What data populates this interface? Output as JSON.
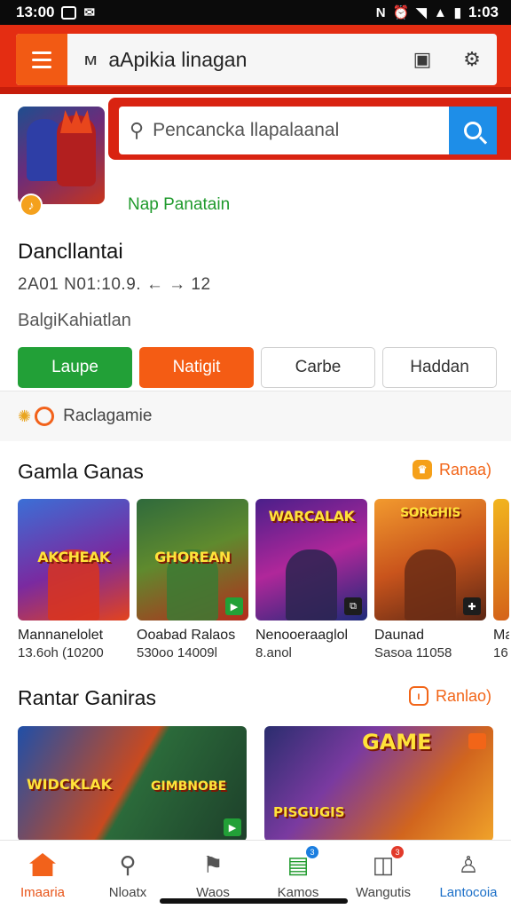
{
  "status_bar": {
    "time": "13:00",
    "right_time": "1:03"
  },
  "header": {
    "app_title": "aApikia linagan"
  },
  "search": {
    "placeholder": "Pencancka llapalaanal"
  },
  "hero": {
    "map_link": "Nap Panatain"
  },
  "info": {
    "headline": "Dancllantai",
    "meta": "2A01 N01:10.9. ← → 12",
    "subhead": "BalgiKahiatlan"
  },
  "action_buttons": [
    "Laupe",
    "Natigit",
    "Carbe",
    "Haddan"
  ],
  "ranking": {
    "label": "Raclagamie"
  },
  "section1": {
    "title": "Gamla Ganas",
    "link": "Ranaa)",
    "cards": [
      {
        "art_title": "AKCHEAK",
        "name": "Mannanelolet",
        "stat": "13.6oh (10200"
      },
      {
        "art_title": "GHOREAN",
        "name": "Ooabad Ralaos",
        "stat": "530oo 14009l"
      },
      {
        "art_title": "WARCALAK",
        "name": "Nenooeraaglol",
        "stat": "8.anol"
      },
      {
        "art_title": "SORGHIS",
        "name": "Daunad",
        "stat": "Sasoa 11058"
      },
      {
        "art_title": "",
        "name": "Ma",
        "stat": "16"
      }
    ]
  },
  "section2": {
    "title": "Rantar Ganiras",
    "link": "Ranlao)",
    "cards": [
      {
        "art_title": "WIDCKLAK"
      },
      {
        "art_title": "GIMBNOBE"
      },
      {
        "art_title": "GAME"
      },
      {
        "art_title": "PISGUGIS"
      }
    ]
  },
  "bottom_nav": [
    {
      "label": "Imaaria",
      "icon": "home-icon"
    },
    {
      "label": "Nloatx",
      "icon": "search-icon"
    },
    {
      "label": "Waos",
      "icon": "flag-icon"
    },
    {
      "label": "Kamos",
      "icon": "gamepad-icon",
      "badge": "3"
    },
    {
      "label": "Wangutis",
      "icon": "bag-icon",
      "badge": "3"
    },
    {
      "label": "Lantocoia",
      "icon": "user-icon"
    }
  ],
  "colors": {
    "accent": "#f2621b",
    "brand_red": "#e42d12",
    "search_blue": "#1e8ee8",
    "green": "#22a037"
  }
}
